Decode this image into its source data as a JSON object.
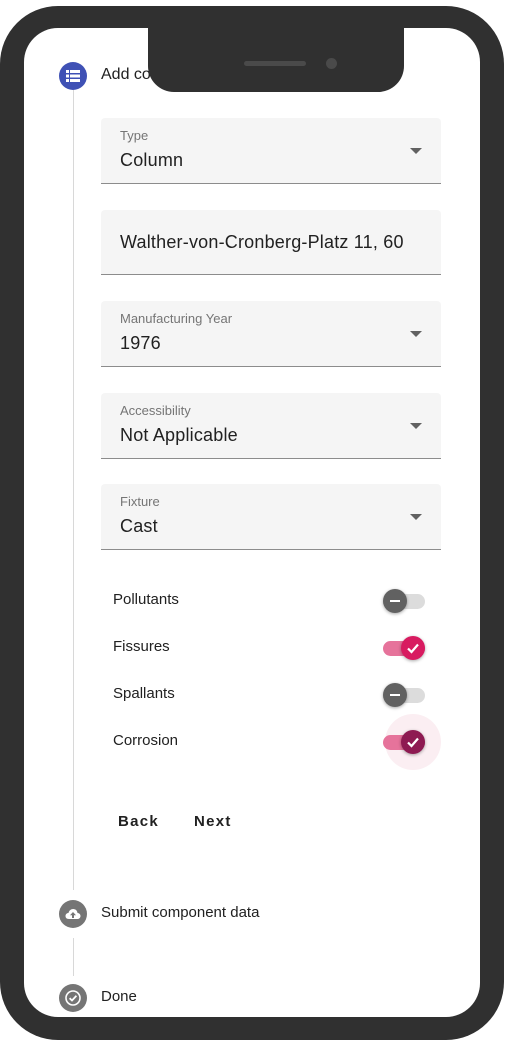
{
  "stepper": {
    "steps": [
      {
        "title": "Add component properties",
        "icon": "list-icon",
        "color": "#3f51b5"
      },
      {
        "title": "Submit component data",
        "icon": "cloud-upload-icon",
        "color": "#757575"
      },
      {
        "title": "Done",
        "icon": "check-circle-icon",
        "color": "#757575"
      }
    ]
  },
  "form": {
    "type": {
      "label": "Type",
      "value": "Column"
    },
    "address": {
      "value": "Walther-von-Cronberg-Platz 11, 60"
    },
    "year": {
      "label": "Manufacturing Year",
      "value": "1976"
    },
    "accessibility": {
      "label": "Accessibility",
      "value": "Not Applicable"
    },
    "fixture": {
      "label": "Fixture",
      "value": "Cast"
    }
  },
  "toggles": [
    {
      "label": "Pollutants",
      "checked": false
    },
    {
      "label": "Fissures",
      "checked": true
    },
    {
      "label": "Spallants",
      "checked": false
    },
    {
      "label": "Corrosion",
      "checked": true,
      "focused": true
    }
  ],
  "actions": {
    "back_label": "Back",
    "next_label": "Next"
  },
  "colors": {
    "primary": "#3f51b5",
    "accent": "#d81b60",
    "accent_dark": "#8e1a52",
    "track_on": "#e6739b",
    "knob_off": "#616161"
  }
}
